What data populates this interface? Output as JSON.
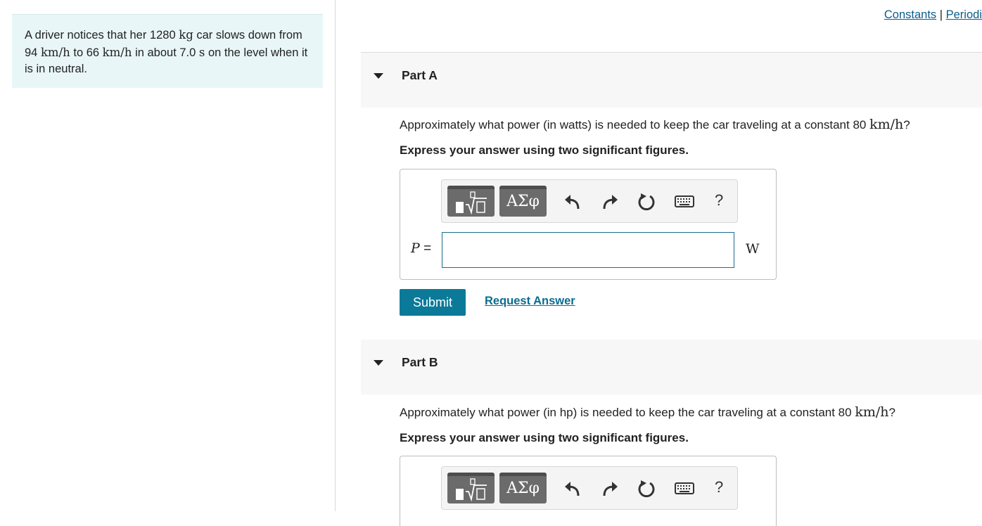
{
  "problem": {
    "text_1": "A driver notices that her 1280 ",
    "unit_kg": "kg",
    "text_2": " car slows down from 94 ",
    "unit_kmh_a": "km/h",
    "text_3": " to 66 ",
    "unit_kmh_b": "km/h",
    "text_4": " in about 7.0 ",
    "unit_s": "s",
    "text_5": " on the level when it is in neutral."
  },
  "top_links": {
    "constants": "Constants",
    "separator": " | ",
    "periodic": "Periodi"
  },
  "part_a": {
    "title": "Part A",
    "question_pre": "Approximately what power (in watts) is needed to keep the car traveling at a constant 80 ",
    "question_unit": "km/h",
    "question_post": "?",
    "instruction": "Express your answer using two significant figures.",
    "toolbar": {
      "greek_label": "ΑΣφ",
      "help_label": "?"
    },
    "variable": "P",
    "equals": " =",
    "input_value": "",
    "unit": "W",
    "submit_label": "Submit",
    "request_label": "Request Answer"
  },
  "part_b": {
    "title": "Part B",
    "question_pre": "Approximately what power (in hp) is needed to keep the car traveling at a constant 80 ",
    "question_unit": "km/h",
    "question_post": "?",
    "instruction": "Express your answer using two significant figures.",
    "toolbar": {
      "greek_label": "ΑΣφ",
      "help_label": "?"
    }
  },
  "colors": {
    "accent": "#0b7a99",
    "link": "#0a5d8c",
    "problem_bg": "#e8f6f7",
    "header_bg": "#f7f7f7"
  },
  "icons": [
    "templates-icon",
    "greek-letters-icon",
    "undo-icon",
    "redo-icon",
    "reset-icon",
    "keyboard-icon",
    "help-icon",
    "collapse-caret-icon"
  ]
}
